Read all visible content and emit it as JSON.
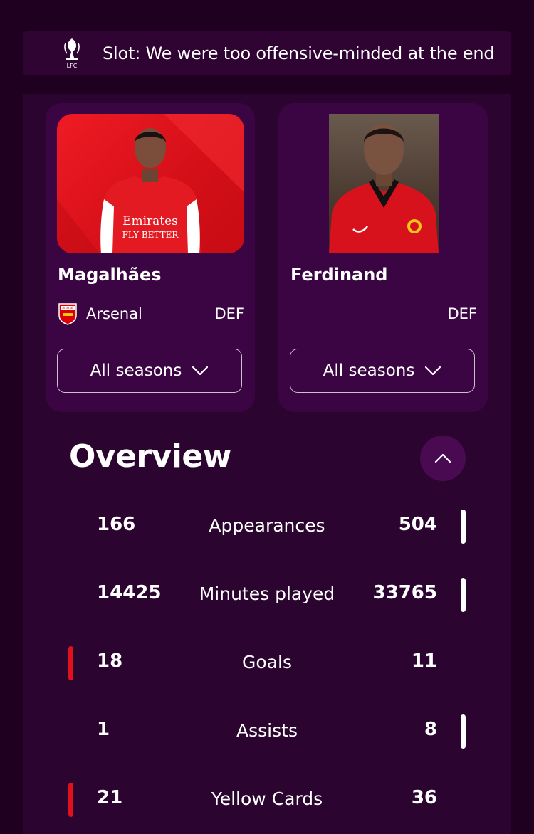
{
  "news": {
    "logo_icon": "liverpool-crest-icon",
    "headline": "Slot: We were too offensive-minded at the end"
  },
  "players": [
    {
      "name": "Magalhães",
      "club": "Arsenal",
      "club_icon": "arsenal-crest-icon",
      "position": "DEF",
      "season_select": "All seasons",
      "photo_bg": "#e8141e"
    },
    {
      "name": "Ferdinand",
      "club": "",
      "position": "DEF",
      "season_select": "All seasons",
      "photo_bg": "#5a4a40"
    }
  ],
  "overview": {
    "title": "Overview",
    "collapse_icon": "chevron-up-icon",
    "stats": [
      {
        "label": "Appearances",
        "left": "166",
        "right": "504",
        "leader": "right"
      },
      {
        "label": "Minutes played",
        "left": "14425",
        "right": "33765",
        "leader": "right"
      },
      {
        "label": "Goals",
        "left": "18",
        "right": "11",
        "leader": "left"
      },
      {
        "label": "Assists",
        "left": "1",
        "right": "8",
        "leader": "right"
      },
      {
        "label": "Yellow Cards",
        "left": "21",
        "right": "36",
        "leader": "left"
      }
    ]
  },
  "colors": {
    "background": "#200020",
    "panel": "#2b0430",
    "card": "#3a0542",
    "left_leader_bar": "#e0101c",
    "right_leader_bar": "#ffffff"
  }
}
